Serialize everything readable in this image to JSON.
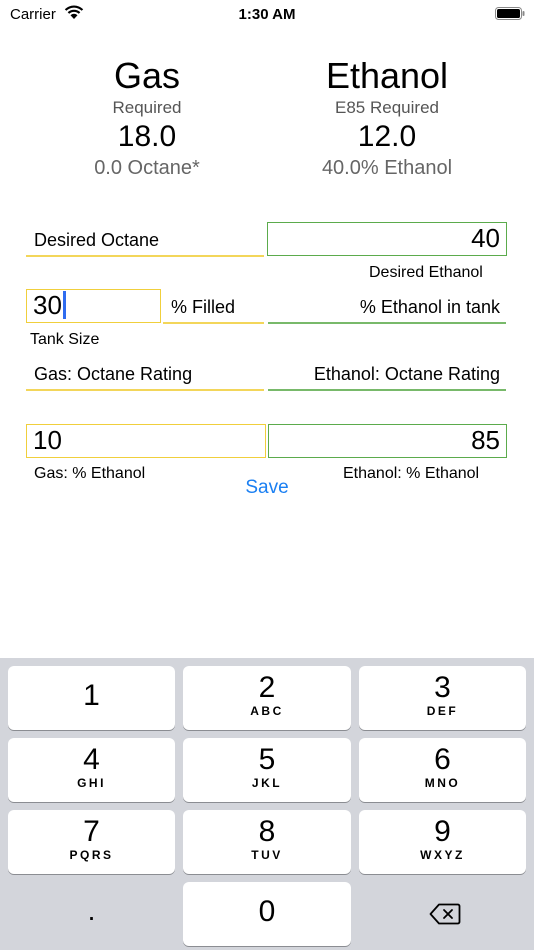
{
  "status": {
    "carrier": "Carrier",
    "time": "1:30 AM"
  },
  "gas": {
    "title": "Gas",
    "required_label": "Required",
    "amount": "18.0",
    "octane": "0.0 Octane*"
  },
  "ethanol": {
    "title": "Ethanol",
    "required_label": "E85 Required",
    "amount": "12.0",
    "percent": "40.0% Ethanol"
  },
  "form": {
    "desired_octane_label": "Desired Octane",
    "desired_ethanol_value": "40",
    "desired_ethanol_label": "Desired Ethanol",
    "tank_size_value": "30",
    "percent_filled_label": "% Filled",
    "ethanol_in_tank_label": "% Ethanol in tank",
    "tank_size_label": "Tank Size",
    "gas_octane_label": "Gas: Octane Rating",
    "ethanol_octane_label": "Ethanol: Octane Rating",
    "gas_ethanol_value": "10",
    "ethanol_ethanol_value": "85",
    "gas_ethanol_label": "Gas: % Ethanol",
    "ethanol_ethanol_label": "Ethanol: % Ethanol",
    "save_label": "Save"
  },
  "keypad": {
    "keys": [
      {
        "digit": "1",
        "letters": ""
      },
      {
        "digit": "2",
        "letters": "ABC"
      },
      {
        "digit": "3",
        "letters": "DEF"
      },
      {
        "digit": "4",
        "letters": "GHI"
      },
      {
        "digit": "5",
        "letters": "JKL"
      },
      {
        "digit": "6",
        "letters": "MNO"
      },
      {
        "digit": "7",
        "letters": "PQRS"
      },
      {
        "digit": "8",
        "letters": "TUV"
      },
      {
        "digit": "9",
        "letters": "WXYZ"
      }
    ],
    "decimal": ".",
    "zero": "0"
  },
  "colors": {
    "gas_accent": "#f0cf3c",
    "ethanol_accent": "#5bab4c",
    "link": "#1a7ff2",
    "caret": "#2f6cf0",
    "keypad_bg": "#d3d5db"
  }
}
